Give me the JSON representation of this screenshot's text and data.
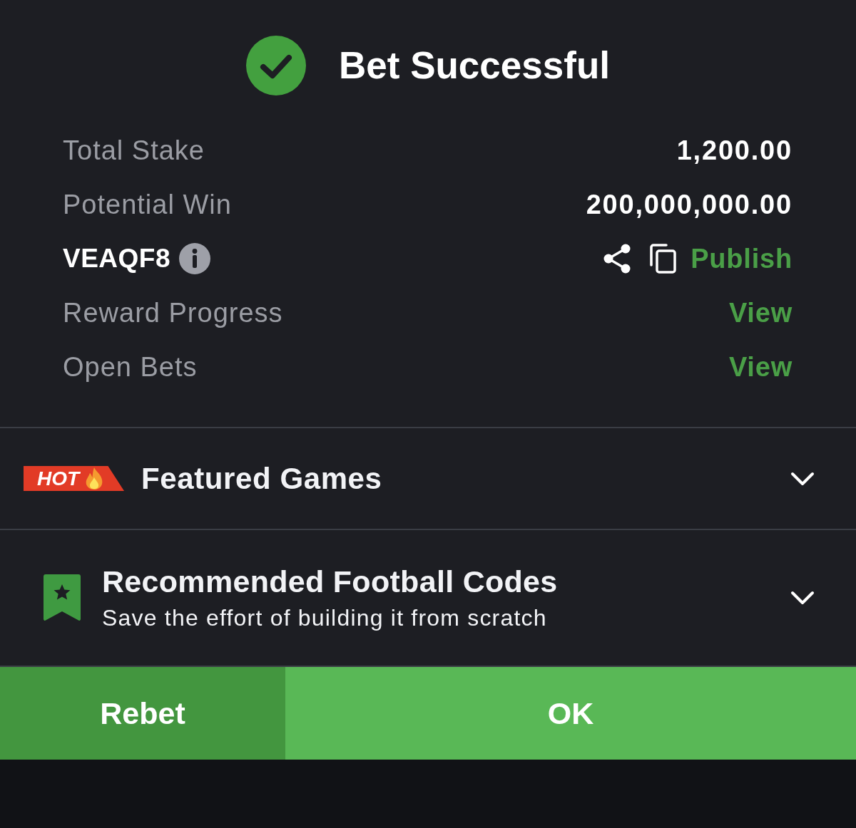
{
  "header": {
    "title": "Bet Successful"
  },
  "summary": [
    {
      "kind": "amount",
      "label": "Total Stake",
      "value": "1,200.00"
    },
    {
      "kind": "amount",
      "label": "Potential Win",
      "value": "200,000,000.00"
    },
    {
      "kind": "code",
      "label": "VEAQF8",
      "action": "Publish"
    },
    {
      "kind": "link",
      "label": "Reward Progress",
      "action": "View"
    },
    {
      "kind": "link",
      "label": "Open Bets",
      "action": "View"
    }
  ],
  "sections": [
    {
      "kind": "featured",
      "badge": "HOT",
      "title": "Featured Games",
      "expanded": false
    },
    {
      "kind": "recommended",
      "title": "Recommended Football Codes",
      "subtitle": "Save the effort of building it from scratch",
      "expanded": false
    }
  ],
  "buttons": [
    {
      "kind": "secondary",
      "label": "Rebet"
    },
    {
      "kind": "primary",
      "label": "OK"
    }
  ]
}
